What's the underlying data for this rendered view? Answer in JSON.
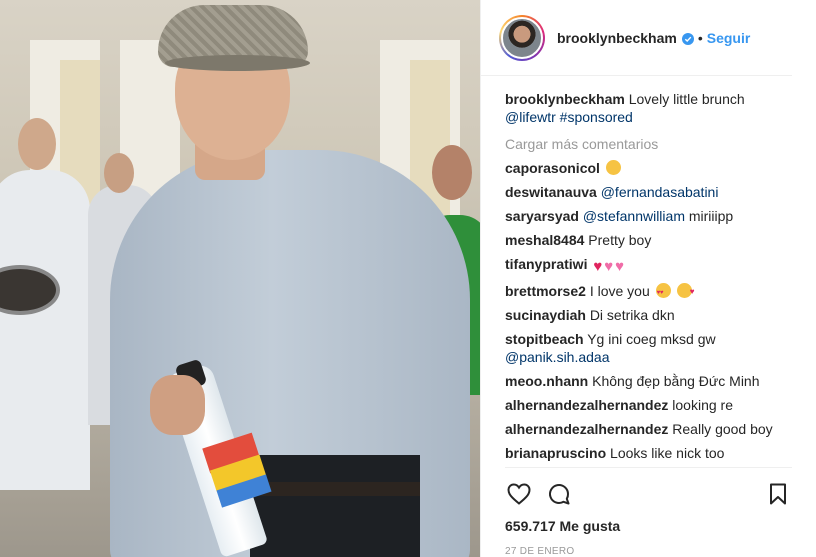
{
  "post": {
    "image_alt": "Photo"
  },
  "header": {
    "username": "brooklynbeckham",
    "separator": "•",
    "follow_label": "Seguir"
  },
  "caption": {
    "username": "brooklynbeckham",
    "text": "Lovely little brunch",
    "mention": "@lifewtr",
    "hashtag": "#sponsored"
  },
  "load_more_label": "Cargar más comentarios",
  "comments": [
    {
      "username": "caporasonicol",
      "text": "",
      "emoji": "smirk"
    },
    {
      "username": "deswitanauva",
      "mention": "@fernandasabatini",
      "text": ""
    },
    {
      "username": "saryarsyad",
      "mention": "@stefannwilliam",
      "text": "miriiipp"
    },
    {
      "username": "meshal8484",
      "text": "Pretty boy"
    },
    {
      "username": "tifanypratiwi",
      "text": "",
      "emoji": "hearts"
    },
    {
      "username": "brettmorse2",
      "text": "I love you",
      "emoji": "hearteyes-kiss"
    },
    {
      "username": "sucinaydiah",
      "text": "Di setrika dkn"
    },
    {
      "username": "stopitbeach",
      "text": "Yg ini coeg mksd gw",
      "mention_after": "@panik.sih.adaa"
    },
    {
      "username": "meoo.nhann",
      "text": "Không đẹp bằng Đức Minh"
    },
    {
      "username": "alhernandezalhernandez",
      "text": "looking re"
    },
    {
      "username": "alhernandezalhernandez",
      "text": "Really good boy"
    },
    {
      "username": "brianapruscino",
      "text": "Looks like nick too"
    }
  ],
  "actions": {
    "like_icon": "heart-outline-icon",
    "comment_icon": "speech-bubble-icon",
    "save_icon": "bookmark-icon",
    "likes": "659.717 Me gusta",
    "date": "27 DE ENERO"
  },
  "colors": {
    "link": "#003569",
    "follow": "#3897f0",
    "muted": "#999999",
    "text": "#262626"
  }
}
